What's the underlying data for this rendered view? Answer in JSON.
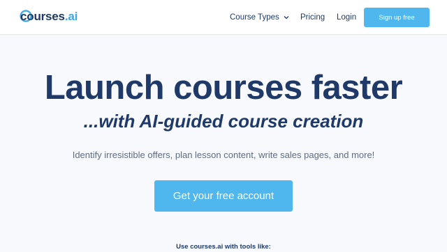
{
  "header": {
    "logo": {
      "prefix": "courses",
      "dot": ".",
      "suffix": "ai"
    },
    "nav": {
      "course_types": "Course Types",
      "pricing": "Pricing",
      "login": "Login"
    },
    "signup_label": "Sign up free"
  },
  "hero": {
    "title": "Launch courses faster",
    "subtitle": "...with AI-guided course creation",
    "description": "Identify irresistible offers, plan lesson content, write sales pages, and more!",
    "cta_label": "Get your free account"
  },
  "tools_caption": "Use courses.ai with tools like:",
  "icons": {
    "logo": "logo-ring-icon",
    "dropdown": "chevron-down-icon"
  },
  "colors": {
    "navy": "#1f3a68",
    "accent": "#4fb6ee",
    "background": "#f7f9fc"
  }
}
